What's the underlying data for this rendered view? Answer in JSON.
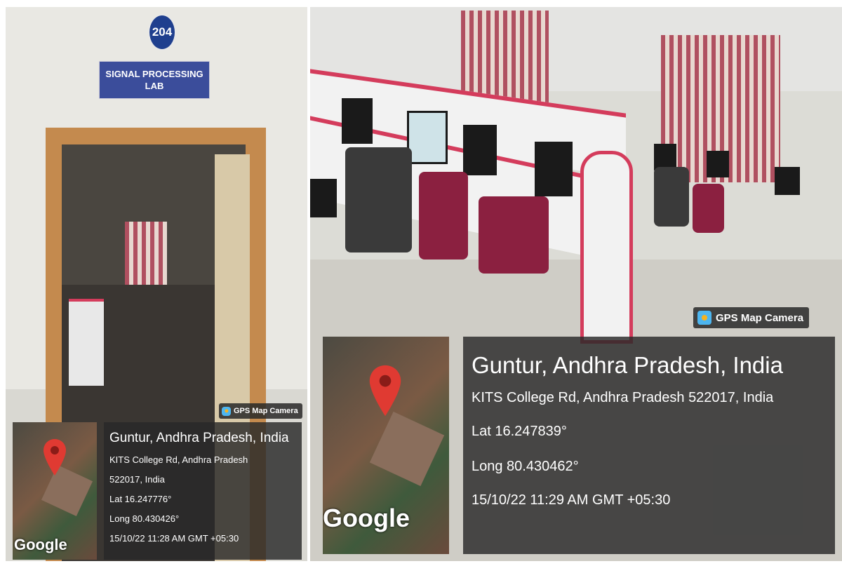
{
  "left_photo": {
    "room_number": "204",
    "sign_line1": "SIGNAL PROCESSING",
    "sign_line2": "LAB",
    "badge": "GPS Map Camera",
    "map_label": "Google",
    "location_title": "Guntur, Andhra Pradesh, India",
    "address_line1": "KITS College Rd, Andhra Pradesh",
    "address_line2": "522017, India",
    "lat": "Lat 16.247776°",
    "long": "Long 80.430426°",
    "datetime": "15/10/22 11:28 AM GMT +05:30"
  },
  "right_photo": {
    "badge": "GPS Map Camera",
    "map_label": "Google",
    "location_title": "Guntur, Andhra Pradesh, India",
    "address": "KITS College Rd, Andhra Pradesh 522017, India",
    "lat": "Lat 16.247839°",
    "long": "Long 80.430462°",
    "datetime": "15/10/22 11:29 AM GMT +05:30"
  },
  "colors": {
    "pin": "#e03a32",
    "sign_blue": "#3b4d9b",
    "overlay": "#282828",
    "desk_trim": "#d43c5c"
  },
  "icons": [
    "map-pin-icon",
    "gps-camera-icon"
  ]
}
